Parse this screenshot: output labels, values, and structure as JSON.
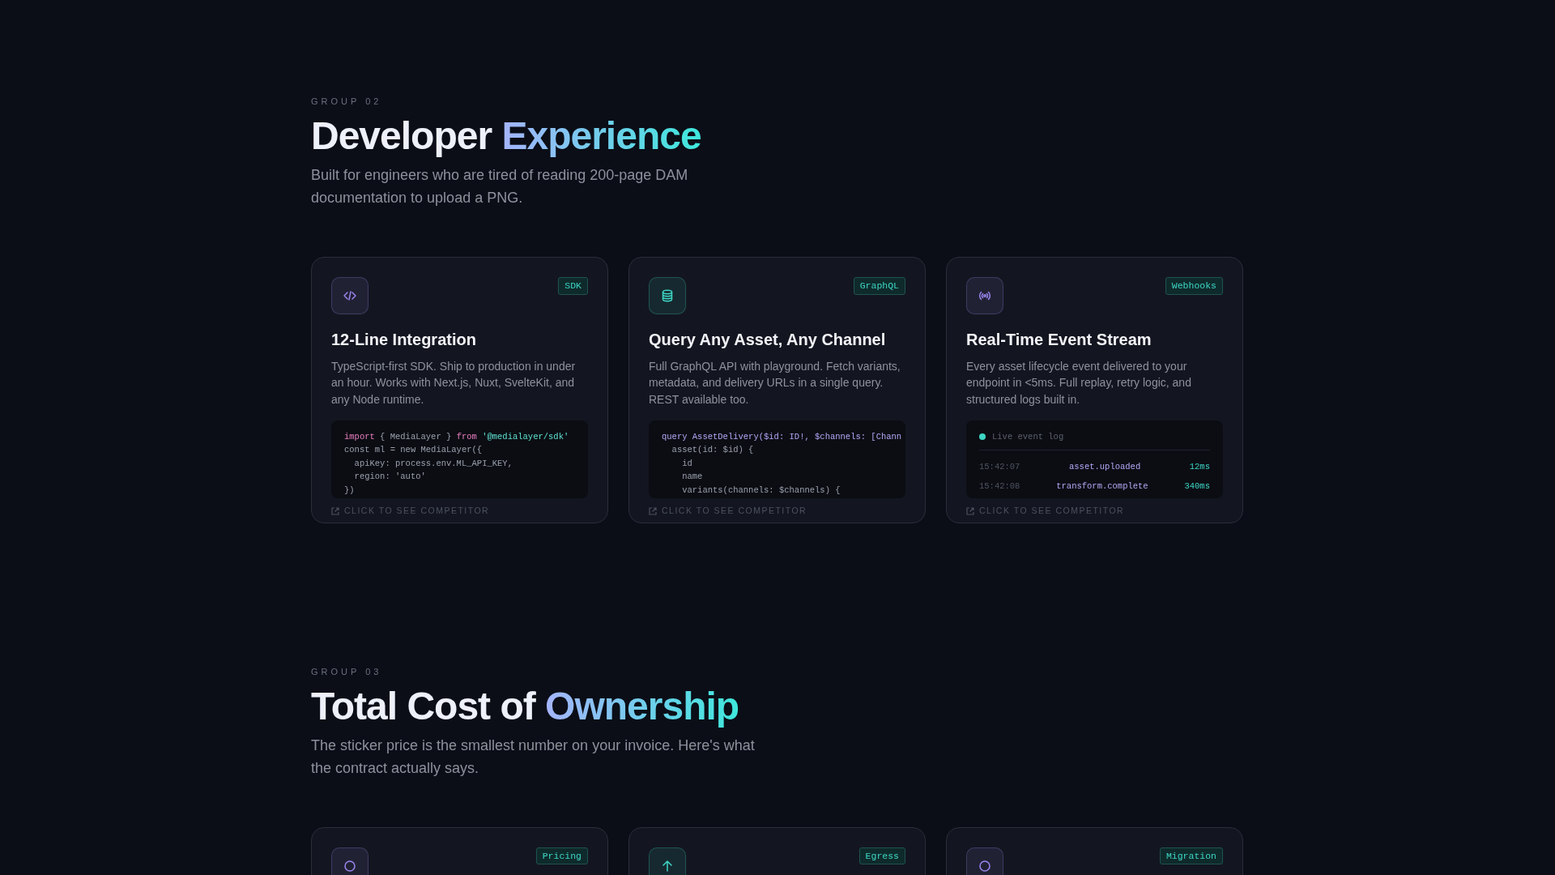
{
  "sections": [
    {
      "eyebrow": "GROUP 02",
      "title": "Developer ",
      "title_accent": "Experience",
      "subtitle": "Built for engineers who are tired of reading 200-page DAM documentation to upload a PNG.",
      "cards": [
        {
          "color": "#9b87f0",
          "badge": "SDK",
          "title": "12-Line Integration",
          "description": "TypeScript-first SDK. Ship to production in under an hour. Works with Next.js, Nuxt, SvelteKit, and any Node runtime.",
          "preview": {
            "kind": "code",
            "lines": [
              [
                {
                  "text": "import",
                  "kind": "keyword"
                },
                {
                  "text": " { MediaLayer } ",
                  "kind": "plain"
                },
                {
                  "text": "from",
                  "kind": "keyword"
                },
                {
                  "text": " '@medialayer/sdk'",
                  "kind": "string"
                }
              ],
              [
                {
                  "text": "const ml = new MediaLayer({",
                  "kind": "plain"
                }
              ],
              [
                {
                  "text": "  apiKey: process.env.ML_API_KEY,",
                  "kind": "plain"
                }
              ],
              [
                {
                  "text": "  region: 'auto'",
                  "kind": "plain"
                }
              ],
              [
                {
                  "text": "})",
                  "kind": "plain"
                }
              ]
            ]
          },
          "footer": "CLICK TO SEE COMPETITOR"
        },
        {
          "color": "#3dd6c4",
          "badge": "GraphQL",
          "title": "Query Any Asset, Any Channel",
          "description": "Full GraphQL API with playground. Fetch variants, metadata, and delivery URLs in a single query. REST available too.",
          "preview": {
            "kind": "code",
            "lines": [
              [
                {
                  "text": "query AssetDelivery($id: ID!, $channels: [Chann",
                  "kind": "query"
                }
              ],
              [
                {
                  "text": "  asset(id: $id) {",
                  "kind": "plain"
                }
              ],
              [
                {
                  "text": "    id",
                  "kind": "plain"
                }
              ],
              [
                {
                  "text": "    name",
                  "kind": "plain"
                }
              ],
              [
                {
                  "text": "    variants(channels: $channels) {",
                  "kind": "plain"
                }
              ]
            ]
          },
          "footer": "CLICK TO SEE COMPETITOR"
        },
        {
          "color": "#9b87f0",
          "badge": "Webhooks",
          "title": "Real-Time Event Stream",
          "description": "Every asset lifecycle event delivered to your endpoint in <5ms. Full replay, retry logic, and structured logs built in.",
          "preview": {
            "kind": "log",
            "heading": "Live event log",
            "rows": [
              {
                "time": "15:42:07",
                "event": "asset.uploaded",
                "duration": "12ms"
              },
              {
                "time": "15:42:08",
                "event": "transform.complete",
                "duration": "340ms"
              }
            ]
          },
          "footer": "CLICK TO SEE COMPETITOR"
        }
      ]
    },
    {
      "eyebrow": "GROUP 03",
      "title": "Total Cost of ",
      "title_accent": "Ownership",
      "subtitle": "The sticker price is the smallest number on your invoice. Here's what the contract actually says.",
      "cards": [
        {
          "color": "#9b87f0",
          "badge": "Pricing"
        },
        {
          "color": "#3dd6c4",
          "badge": "Egress"
        },
        {
          "color": "#9b87f0",
          "badge": "Migration"
        }
      ]
    }
  ]
}
